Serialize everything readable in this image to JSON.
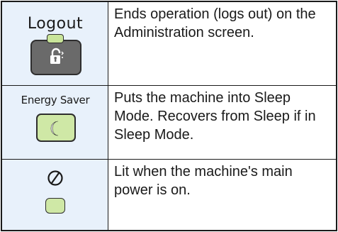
{
  "rows": [
    {
      "key_label": "Logout",
      "key_icon": "lock-icon",
      "description": "Ends operation (logs out) on the Administration screen."
    },
    {
      "key_label": "Energy Saver",
      "key_icon": "moon-icon",
      "description": "Puts the machine into Sleep Mode. Recovers from Sleep if in Sleep Mode."
    },
    {
      "key_label": "",
      "key_icon": "power-icon",
      "description": "Lit when the machine's main power is on."
    }
  ],
  "colors": {
    "left_cell_bg": "#e8f1fb",
    "key_gray": "#6a6a6a",
    "indicator_green": "#cfe8a6",
    "border": "#1a1a1a"
  }
}
